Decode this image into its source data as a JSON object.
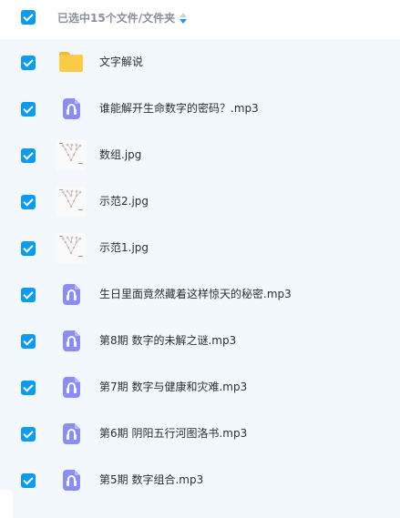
{
  "header": {
    "selection_label": "已选中15个文件/文件夹",
    "sort_icon": "sort-arrows-icon"
  },
  "files": [
    {
      "name": "文字解说",
      "type": "folder",
      "icon": "folder-icon"
    },
    {
      "name": "谁能解开生命数字的密码？.mp3",
      "type": "audio",
      "icon": "audio-file-icon"
    },
    {
      "name": "数组.jpg",
      "type": "image",
      "icon": "image-thumbnail"
    },
    {
      "name": "示范2.jpg",
      "type": "image",
      "icon": "image-thumbnail"
    },
    {
      "name": "示范1.jpg",
      "type": "image",
      "icon": "image-thumbnail"
    },
    {
      "name": "生日里面竟然藏着这样惊天的秘密.mp3",
      "type": "audio",
      "icon": "audio-file-icon"
    },
    {
      "name": "第8期 数字的未解之谜.mp3",
      "type": "audio",
      "icon": "audio-file-icon"
    },
    {
      "name": "第7期 数字与健康和灾难.mp3",
      "type": "audio",
      "icon": "audio-file-icon"
    },
    {
      "name": "第6期 阴阳五行河图洛书.mp3",
      "type": "audio",
      "icon": "audio-file-icon"
    },
    {
      "name": "第5期 数字组合.mp3",
      "type": "audio",
      "icon": "audio-file-icon"
    }
  ],
  "colors": {
    "checkbox": "#0d9bf0",
    "list_background": "#f3f8fe",
    "audio_icon": "#8c8df3",
    "folder_icon": "#fccb47"
  }
}
